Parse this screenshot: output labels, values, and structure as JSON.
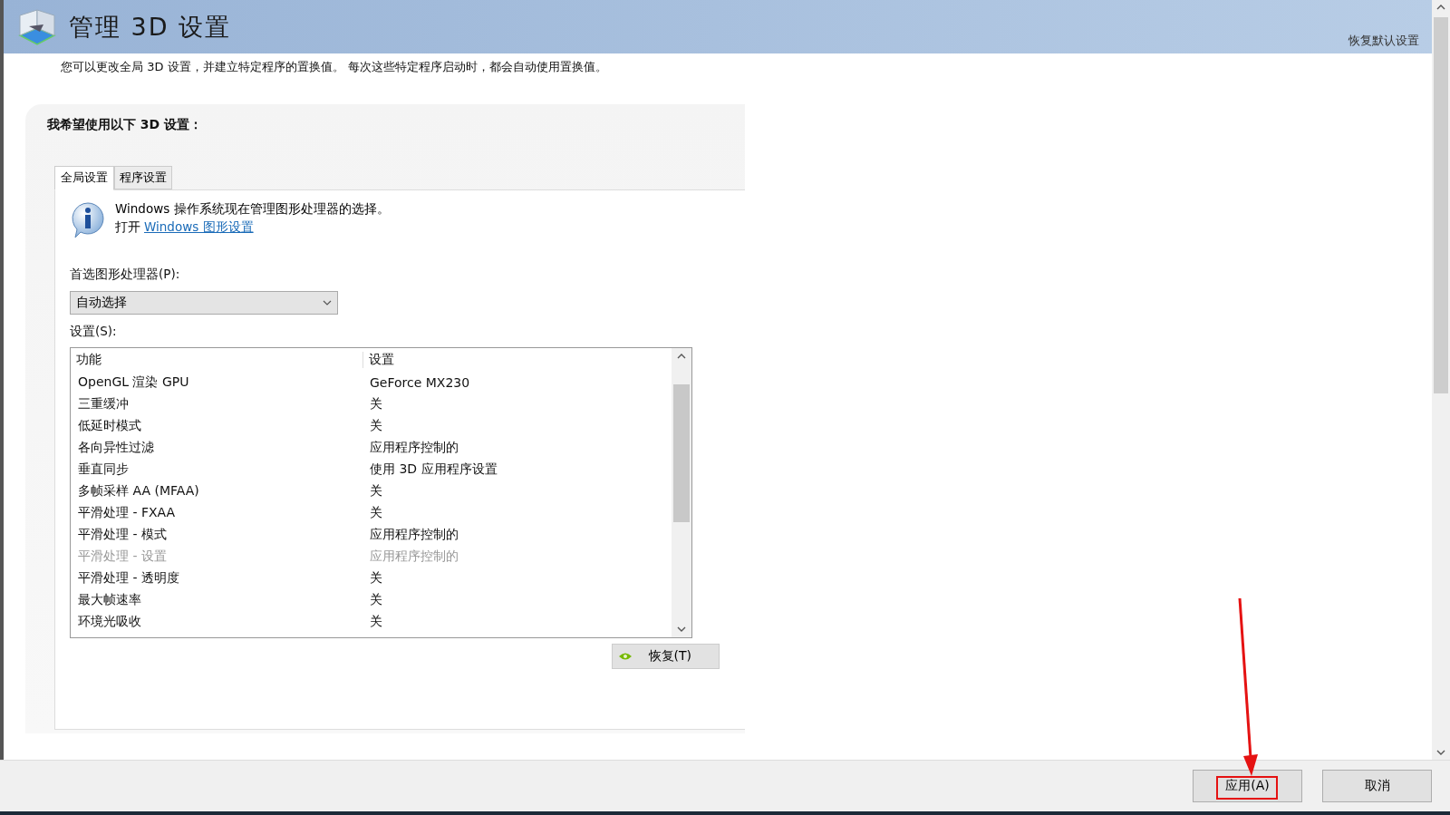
{
  "header": {
    "title": "管理 3D 设置",
    "restore_defaults": "恢复默认设置"
  },
  "description": "您可以更改全局 3D 设置，并建立特定程序的置换值。 每次这些特定程序启动时，都会自动使用置换值。",
  "panel": {
    "heading": "我希望使用以下 3D 设置：",
    "tabs": [
      {
        "label": "全局设置",
        "selected": true
      },
      {
        "label": "程序设置",
        "selected": false
      }
    ],
    "info": {
      "message": "Windows 操作系统现在管理图形处理器的选择。",
      "link_prefix": "打开",
      "link": "Windows 图形设置"
    },
    "gpu_label": "首选图形处理器(P):",
    "gpu_select": {
      "value": "自动选择"
    },
    "settings_label": "设置(S):",
    "table": {
      "columns": [
        "功能",
        "设置"
      ],
      "rows": [
        {
          "feature": "OpenGL 渲染 GPU",
          "setting": "GeForce MX230",
          "disabled": false
        },
        {
          "feature": "三重缓冲",
          "setting": "关",
          "disabled": false
        },
        {
          "feature": "低延时模式",
          "setting": "关",
          "disabled": false
        },
        {
          "feature": "各向异性过滤",
          "setting": "应用程序控制的",
          "disabled": false
        },
        {
          "feature": "垂直同步",
          "setting": "使用 3D 应用程序设置",
          "disabled": false
        },
        {
          "feature": "多帧采样 AA (MFAA)",
          "setting": "关",
          "disabled": false
        },
        {
          "feature": "平滑处理 - FXAA",
          "setting": "关",
          "disabled": false
        },
        {
          "feature": "平滑处理 - 模式",
          "setting": "应用程序控制的",
          "disabled": false
        },
        {
          "feature": "平滑处理 - 设置",
          "setting": "应用程序控制的",
          "disabled": true
        },
        {
          "feature": "平滑处理 - 透明度",
          "setting": "关",
          "disabled": false
        },
        {
          "feature": "最大帧速率",
          "setting": "关",
          "disabled": false
        },
        {
          "feature": "环境光吸收",
          "setting": "关",
          "disabled": false
        }
      ]
    },
    "restore_button": "恢复(T)"
  },
  "footer": {
    "buttons": [
      {
        "label": "应用(A)",
        "highlighted": true
      },
      {
        "label": "取消",
        "highlighted": false
      }
    ]
  }
}
